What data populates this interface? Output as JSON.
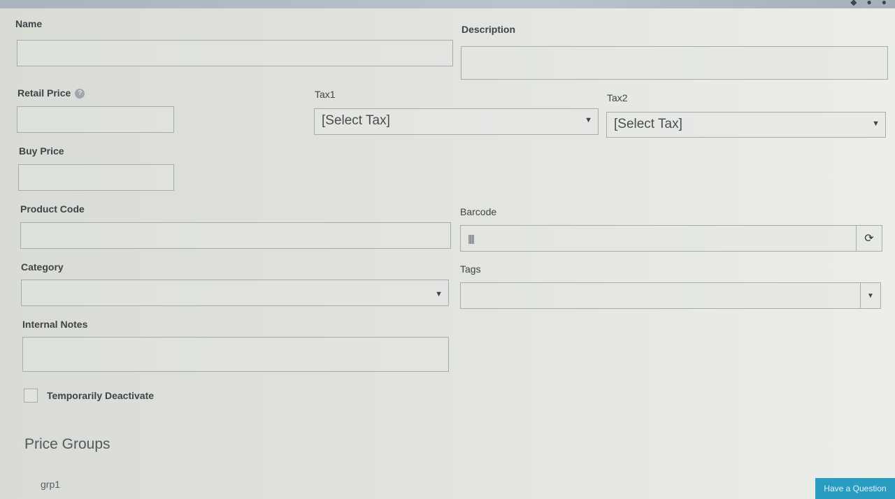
{
  "labels": {
    "name": "Name",
    "description": "Description",
    "retail_price": "Retail Price",
    "tax1": "Tax1",
    "tax2": "Tax2",
    "buy_price": "Buy Price",
    "product_code": "Product Code",
    "barcode": "Barcode",
    "category": "Category",
    "tags": "Tags",
    "internal_notes": "Internal Notes",
    "temporarily_deactivate": "Temporarily Deactivate"
  },
  "fields": {
    "name": "",
    "description": "",
    "retail_price": "",
    "buy_price": "",
    "product_code": "",
    "barcode": "",
    "internal_notes": ""
  },
  "selects": {
    "tax1": "[Select Tax]",
    "tax2": "[Select Tax]",
    "category": "",
    "tags": ""
  },
  "icons": {
    "help": "?",
    "caret": "▼",
    "reload": "⟳",
    "barcode": "|||||"
  },
  "sections": {
    "price_groups": "Price Groups",
    "group_1": "grp1"
  },
  "cta": "Have a Question",
  "colors": {
    "accent": "#2a9cc2",
    "border": "#a7abaa"
  }
}
